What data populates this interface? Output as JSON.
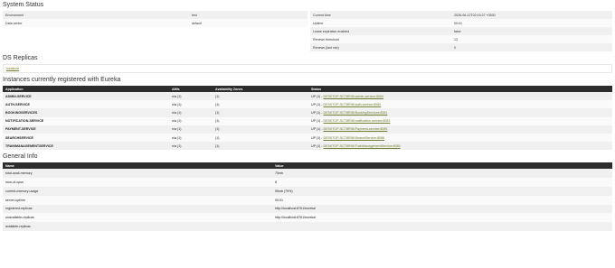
{
  "system_status": {
    "title": "System Status",
    "left": [
      {
        "key": "Environment",
        "value": "test"
      },
      {
        "key": "Data center",
        "value": "default"
      }
    ],
    "right": [
      {
        "key": "Current time",
        "value": "2026-06-12T02:15:27 +0530"
      },
      {
        "key": "Uptime",
        "value": "00:01"
      },
      {
        "key": "Lease expiration enabled",
        "value": "false"
      },
      {
        "key": "Renews threshold",
        "value": "13"
      },
      {
        "key": "Renews (last min)",
        "value": "0"
      }
    ]
  },
  "ds_replicas": {
    "title": "DS Replicas",
    "items": [
      "localhost"
    ]
  },
  "instances": {
    "title": "Instances currently registered with Eureka",
    "headers": [
      "Application",
      "AMIs",
      "Availability Zones",
      "Status"
    ],
    "rows": [
      {
        "app": "ADMIN-SERVICE",
        "amis": "n/a (1)",
        "zones": "(1)",
        "status_prefix": "UP (1) - ",
        "instance": "DESKTOP-SCT8R98:admin-service:8084"
      },
      {
        "app": "AUTH-SERVICE",
        "amis": "n/a (1)",
        "zones": "(1)",
        "status_prefix": "UP (1) - ",
        "instance": "DESKTOP-SCT8R98:auth-service:8080"
      },
      {
        "app": "BOOKINGSERVICES",
        "amis": "n/a (1)",
        "zones": "(1)",
        "status_prefix": "UP (1) - ",
        "instance": "DESKTOP-SCT8R98:BookingServices:8081"
      },
      {
        "app": "NOTIFICATION-SERVICE",
        "amis": "n/a (1)",
        "zones": "(1)",
        "status_prefix": "UP (1) - ",
        "instance": "DESKTOP-SCT8R98:notification-service:8083"
      },
      {
        "app": "PAYMENT-SERVICE",
        "amis": "n/a (1)",
        "zones": "(1)",
        "status_prefix": "UP (1) - ",
        "instance": "DESKTOP-SCT8R98:Payment-service:8085"
      },
      {
        "app": "SEARCHSERVICE",
        "amis": "n/a (1)",
        "zones": "(1)",
        "status_prefix": "UP (1) - ",
        "instance": "DESKTOP-SCT8R98:SearchService:8086"
      },
      {
        "app": "TRAINMANAGEMENTSERVICE",
        "amis": "n/a (1)",
        "zones": "(1)",
        "status_prefix": "UP (1) - ",
        "instance": "DESKTOP-SCT8R98:TrainManagementService:8080"
      }
    ]
  },
  "general_info": {
    "title": "General Info",
    "headers": [
      "Name",
      "Value"
    ],
    "rows": [
      {
        "name": "total-avail-memory",
        "value": "75mb"
      },
      {
        "name": "num-of-cpus",
        "value": "8"
      },
      {
        "name": "current-memory-usage",
        "value": "59mb (79%)"
      },
      {
        "name": "server-uptime",
        "value": "00:01"
      },
      {
        "name": "registered-replicas",
        "value": "http://localhost:8761/eureka/"
      },
      {
        "name": "unavailable-replicas",
        "value": "http://localhost:8761/eureka/"
      },
      {
        "name": "available-replicas",
        "value": ""
      }
    ]
  }
}
